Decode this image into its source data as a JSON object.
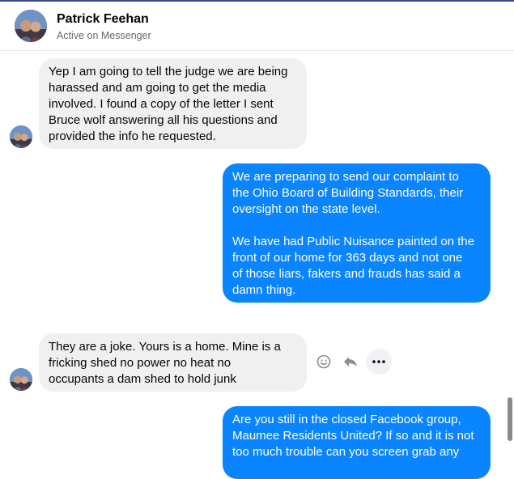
{
  "header": {
    "name": "Patrick Feehan",
    "status": "Active on Messenger"
  },
  "messages": [
    {
      "direction": "incoming",
      "text": "Yep I am going to tell the judge we are being\nharassed and am going to get the media\ninvolved. I found a copy of the letter I sent\nBruce wolf answering all his questions and\nprovided the info he requested."
    },
    {
      "direction": "outgoing",
      "text": "We are preparing to send our complaint to\nthe Ohio Board of Building Standards, their\noversight on the state level.\n\nWe have had Public Nuisance painted on the\nfront of our home for 363 days and not one\nof those liars, fakers and frauds has said a\ndamn thing."
    },
    {
      "direction": "incoming",
      "text": "They are a joke. Yours is a home. Mine is a\nfricking shed no power no heat no\noccupants a dam shed to hold junk"
    },
    {
      "direction": "outgoing",
      "text": "Are you still in the closed Facebook group,\nMaumee Residents United? If so and it is not\ntoo much trouble can you screen grab any"
    }
  ],
  "message_actions": {
    "react_icon": "smiley-icon",
    "reply_icon": "reply-icon",
    "more_icon": "more-options-icon"
  },
  "colors": {
    "outgoing_bubble": "#0a84ff",
    "incoming_bubble": "#f0f0f0"
  }
}
